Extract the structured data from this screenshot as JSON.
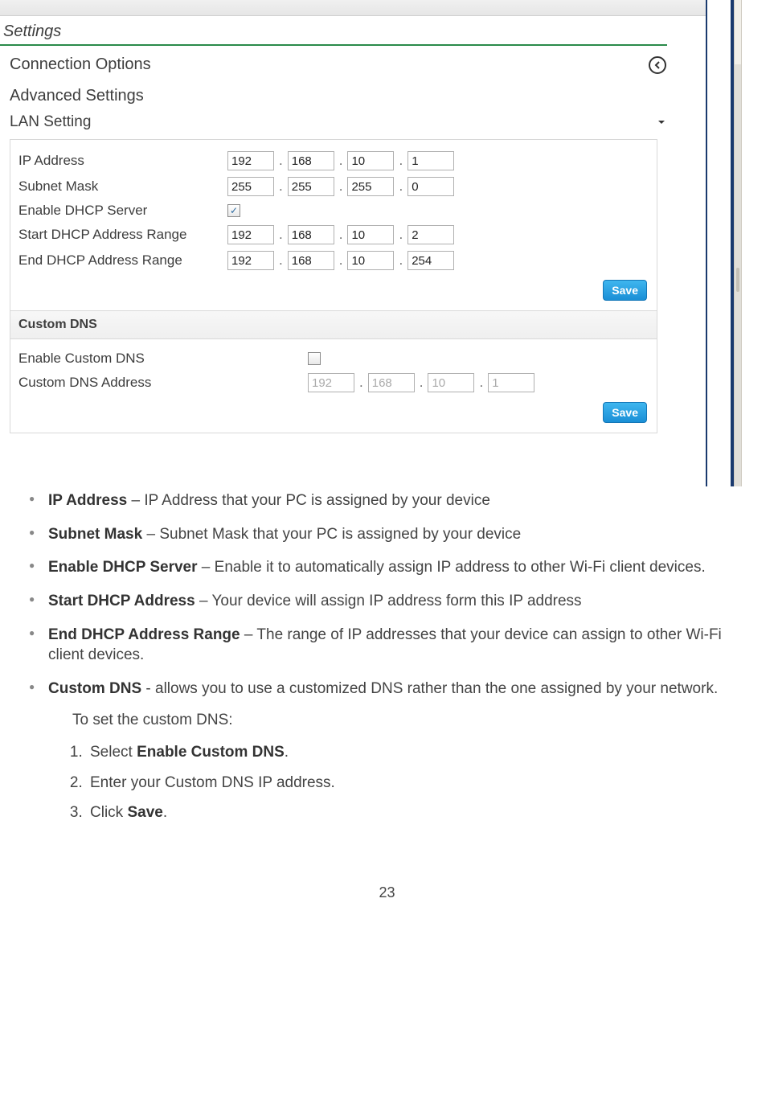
{
  "settings": {
    "title": "Settings",
    "connection_options": "Connection Options",
    "advanced_settings": "Advanced Settings",
    "lan_setting": "LAN Setting"
  },
  "lan": {
    "ip_address_label": "IP Address",
    "ip_address": [
      "192",
      "168",
      "10",
      "1"
    ],
    "subnet_mask_label": "Subnet Mask",
    "subnet_mask": [
      "255",
      "255",
      "255",
      "0"
    ],
    "enable_dhcp_label": "Enable DHCP Server",
    "enable_dhcp_checked": true,
    "start_dhcp_label": "Start DHCP Address Range",
    "start_dhcp": [
      "192",
      "168",
      "10",
      "2"
    ],
    "end_dhcp_label": "End DHCP Address Range",
    "end_dhcp": [
      "192",
      "168",
      "10",
      "254"
    ],
    "save_label": "Save"
  },
  "custom_dns": {
    "heading": "Custom DNS",
    "enable_label": "Enable Custom DNS",
    "enable_checked": false,
    "address_label": "Custom DNS Address",
    "address": [
      "192",
      "168",
      "10",
      "1"
    ],
    "save_label": "Save"
  },
  "doc": {
    "items": [
      {
        "term": "IP Address",
        "desc": " – IP Address that your PC is assigned by your device"
      },
      {
        "term": "Subnet Mask",
        "desc": " – Subnet Mask that your PC is assigned by your device"
      },
      {
        "term": "Enable DHCP Server",
        "desc": " – Enable it to automatically assign IP address to other Wi-Fi client devices."
      },
      {
        "term": "Start DHCP Address",
        "desc": " – Your device will assign IP address form this IP address"
      },
      {
        "term": "End DHCP Address Range",
        "desc": " – The range of IP addresses that your device can assign to other Wi-Fi client devices."
      },
      {
        "term": "Custom DNS",
        "desc": " - allows you to use a customized DNS rather than the one assigned by your network."
      }
    ],
    "subtext": "To set the custom DNS:",
    "steps_prefix": [
      "Select ",
      "Enter your Custom DNS IP address.",
      "Click "
    ],
    "step1_bold": "Enable Custom DNS",
    "step3_bold": "Save",
    "dot": "."
  },
  "page_number": "23"
}
